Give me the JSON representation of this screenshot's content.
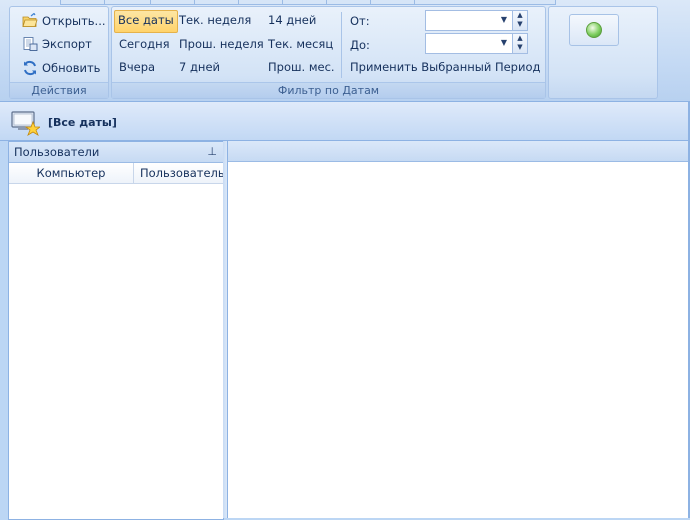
{
  "actions": {
    "group_label": "Действия",
    "open_label": "Открыть...",
    "export_label": "Экспорт",
    "refresh_label": "Обновить"
  },
  "date_filter": {
    "group_label": "Фильтр по Датам",
    "presets": {
      "all": "Все даты",
      "today": "Сегодня",
      "yesterday": "Вчера",
      "this_week": "Тек. неделя",
      "last_week": "Прош. неделя",
      "seven_days": "7 дней",
      "fourteen_days": "14 дней",
      "this_month": "Тек. месяц",
      "last_month": "Прош. мес."
    },
    "active_preset": "all",
    "from_label": "От:",
    "from_value": "",
    "to_label": "До:",
    "to_value": "",
    "apply_label": "Применить Выбранный Период"
  },
  "toolbar": {
    "current_filter": "[Все даты]"
  },
  "users_panel": {
    "title": "Пользователи",
    "columns": [
      "Компьютер",
      "Пользователь"
    ],
    "rows": []
  },
  "colors": {
    "ribbon_bg": "#c5daf4",
    "active_preset_bg": "#ffd36b",
    "accent": "#8db2e3"
  }
}
